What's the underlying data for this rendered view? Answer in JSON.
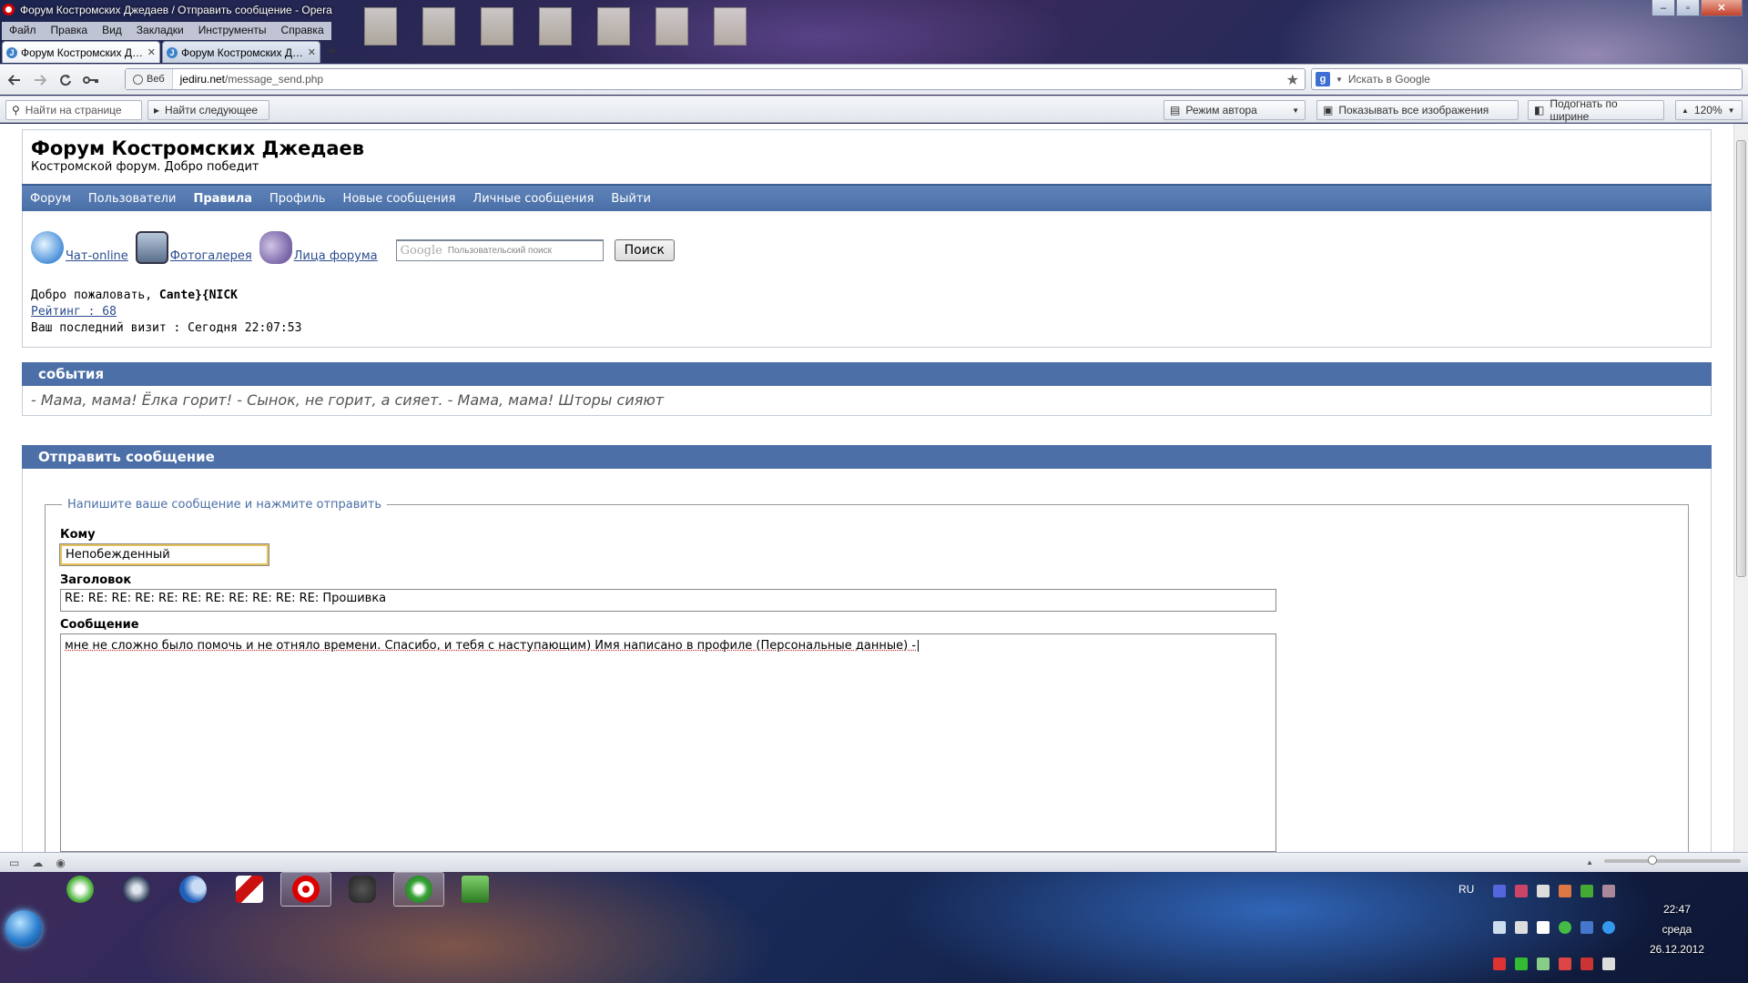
{
  "window": {
    "title": "Форум Костромских Джедаев / Отправить сообщение - Opera",
    "min": "‒",
    "max": "▫",
    "close": "✕"
  },
  "menu": [
    "Файл",
    "Правка",
    "Вид",
    "Закладки",
    "Инструменты",
    "Справка"
  ],
  "tabs": [
    {
      "label": "Форум Костромских Д…",
      "close": "✕",
      "active": true
    },
    {
      "label": "Форум Костромских Д…",
      "close": "✕",
      "active": false
    }
  ],
  "newtab": "+",
  "nav": {
    "back_icon": "back-arrow-icon",
    "forward_icon": "forward-arrow-icon",
    "reload_icon": "reload-icon",
    "key_icon": "key-icon",
    "badge": "Веб",
    "url_host": "jediru.net",
    "url_path": "/message_send.php",
    "search_engine": "g",
    "search_placeholder": "Искать в Google"
  },
  "findbar": {
    "find_placeholder": "Найти на странице",
    "find_next": "Найти следующее",
    "author_mode": "Режим автора",
    "show_images": "Показывать все изображения",
    "fit_width": "Подогнать по ширине",
    "zoom": "120%"
  },
  "forum": {
    "title": "Форум Костромских Джедаев",
    "subtitle": "Костромской форум. Добро победит",
    "nav": [
      "Форум",
      "Пользователи",
      "Правила",
      "Профиль",
      "Новые сообщения",
      "Личные сообщения",
      "Выйти"
    ],
    "nav_bold_index": 2,
    "quicklinks": [
      {
        "label": "Чат-online",
        "icon": "chat-icon"
      },
      {
        "label": "Фотогалерея",
        "icon": "photo-gallery-icon"
      },
      {
        "label": "Лица форума",
        "icon": "theater-masks-icon"
      }
    ],
    "google_logo": "Google",
    "google_placeholder": "Пользовательский поиск",
    "search_button": "Поиск",
    "welcome_prefix": "Добро пожаловать, ",
    "username": "Cante}{NICK",
    "rating": "Рейтинг : 68",
    "last_visit": "Ваш последний визит : Сегодня 22:07:53",
    "events_header": "события",
    "events_text": "- Мама, мама! Ёлка горит! - Сынок, не горит, а сияет. - Мама, мама! Шторы сияют",
    "send_header": "Отправить сообщение",
    "legend": "Напишите ваше сообщение и нажмите отправить",
    "to_label": "Кому",
    "to_value": "Непобежденный",
    "subject_label": "Заголовок",
    "subject_value": "RE: RE: RE: RE: RE: RE: RE: RE: RE: RE: RE: Прошивка",
    "message_label": "Сообщение",
    "message_value": "мне не сложно было помочь и не отняло времени. Спасибо, и тебя с наступающим) Имя написано в профиле (Персональные данные) -"
  },
  "status": {
    "zoom_slider": 0.35
  },
  "tray": {
    "lang": "RU",
    "time": "22:47",
    "weekday": "среда",
    "date": "26.12.2012"
  },
  "colors": {
    "nav_blue": "#4a6fa7",
    "link": "#2a4c90",
    "legend": "#4c6fa7"
  }
}
